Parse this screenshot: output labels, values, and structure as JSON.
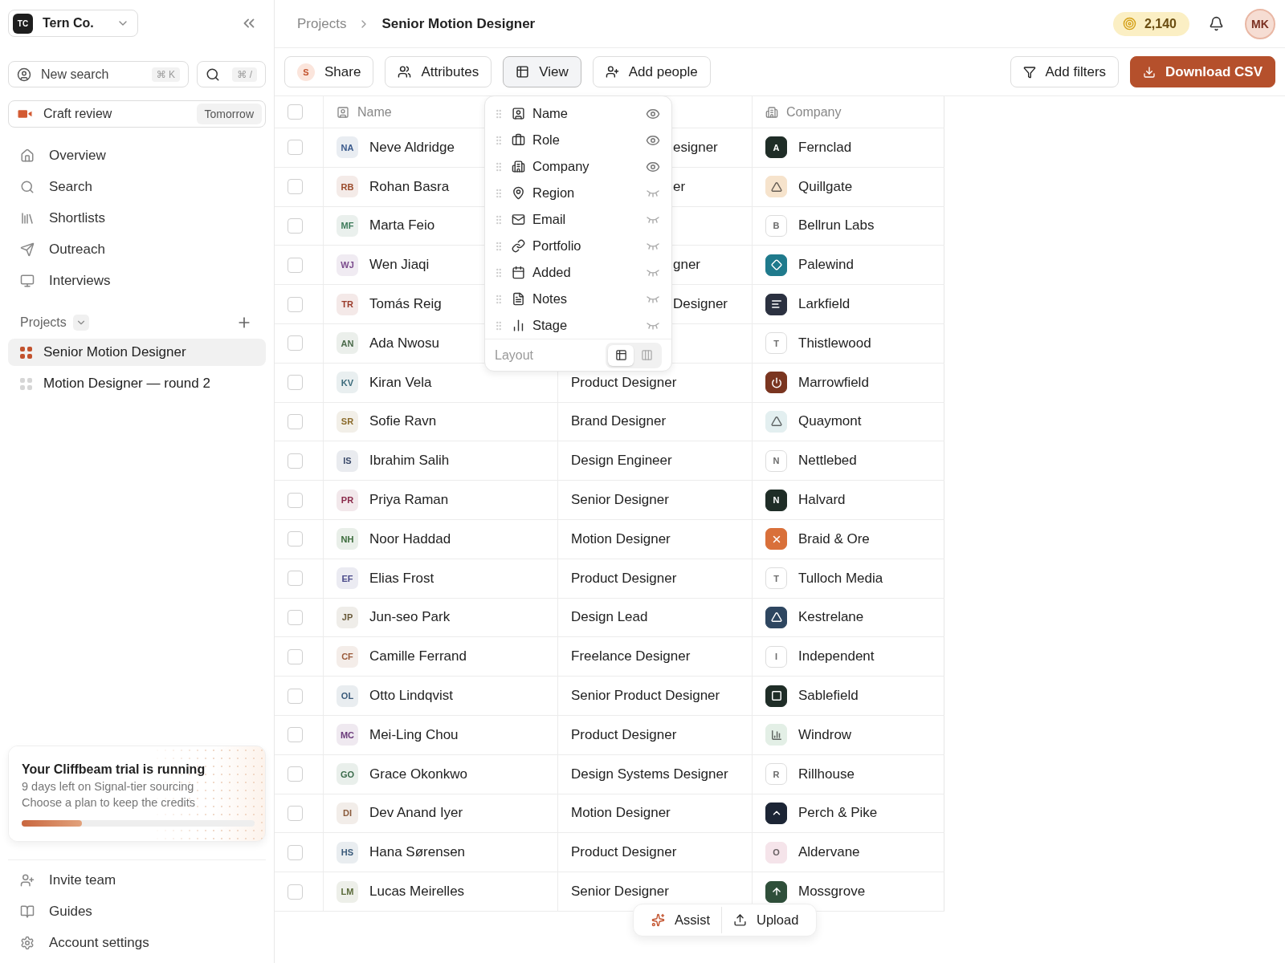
{
  "workspace": {
    "initials": "TC",
    "name": "Tern Co."
  },
  "quick": {
    "new_search": "New search",
    "new_search_shortcut": "⌘ K",
    "search_shortcut": "⌘ /"
  },
  "meeting": {
    "title": "Craft review",
    "when": "Tomorrow"
  },
  "nav": [
    "Overview",
    "Search",
    "Shortlists",
    "Outreach",
    "Interviews"
  ],
  "projects": {
    "title": "Projects",
    "items": [
      {
        "label": "Senior Motion Designer",
        "selected": true
      },
      {
        "label": "Motion Designer — round 2",
        "selected": false
      }
    ]
  },
  "trial": {
    "title": "Your Cliffbeam trial is running",
    "lines": [
      "9 days left on Signal-tier sourcing",
      "Choose a plan to keep the credits"
    ],
    "level": 0.26
  },
  "footer_nav": [
    "Invite team",
    "Guides",
    "Account settings"
  ],
  "breadcrumb": [
    "Projects",
    "Senior Motion Designer"
  ],
  "credits": "2,140",
  "user_initials": "MK",
  "toolbar": [
    {
      "label": "Share",
      "kind": "share",
      "badge": "S",
      "selected": false
    },
    {
      "label": "Attributes",
      "kind": "users",
      "selected": false
    },
    {
      "label": "View",
      "kind": "table",
      "selected": true
    },
    {
      "label": "Add people",
      "kind": "user-plus",
      "selected": false
    }
  ],
  "filters": "Add filters",
  "download": "Download CSV",
  "columns": {
    "name": "Name",
    "company": "Company",
    "all_checked": false
  },
  "rows": [
    {
      "checked": false,
      "initials": "NA",
      "color": "#3a5a8c",
      "name": "Neve Aldridge",
      "role": "esigner",
      "covered": true,
      "company": "Fernclad",
      "logo": {
        "kind": "letter",
        "text": "A",
        "color": "#1f2d27"
      }
    },
    {
      "checked": false,
      "initials": "RB",
      "color": "#9a4a2a",
      "name": "Rohan Basra",
      "role": "er",
      "covered": true,
      "company": "Quillgate",
      "logo": {
        "kind": "triangle",
        "color": "#f6e3cc"
      }
    },
    {
      "checked": false,
      "initials": "MF",
      "color": "#3d7a5a",
      "name": "Marta Feio",
      "company": "Bellrun Labs",
      "logo": {
        "kind": "letter",
        "text": "B",
        "color": "#ffffff"
      }
    },
    {
      "checked": false,
      "initials": "WJ",
      "color": "#7a4a8c",
      "name": "Wen Jiaqi",
      "role": "gner",
      "covered": true,
      "company": "Palewind",
      "logo": {
        "kind": "diamond",
        "color": "#1f7a8c"
      }
    },
    {
      "checked": false,
      "initials": "TR",
      "color": "#9a3a2a",
      "name": "Tomás Reig",
      "role": "Designer",
      "covered": true,
      "company": "Larkfield",
      "logo": {
        "kind": "lines",
        "color": "#2b3140"
      }
    },
    {
      "checked": false,
      "initials": "AN",
      "color": "#4a6a4a",
      "name": "Ada Nwosu",
      "company": "Thistlewood",
      "logo": {
        "kind": "letter",
        "text": "T",
        "color": "#ffffff"
      }
    },
    {
      "checked": false,
      "initials": "KV",
      "color": "#3a6a7a",
      "name": "Kiran Vela",
      "role": "Product Designer",
      "company": "Marrowfield",
      "logo": {
        "kind": "power",
        "color": "#7a3520"
      }
    },
    {
      "checked": false,
      "initials": "SR",
      "color": "#8a6a2a",
      "name": "Sofie Ravn",
      "role": "Brand Designer",
      "company": "Quaymont",
      "logo": {
        "kind": "triangle",
        "color": "#e3eff0"
      }
    },
    {
      "checked": false,
      "initials": "IS",
      "color": "#3a4a6a",
      "name": "Ibrahim Salih",
      "role": "Design Engineer",
      "company": "Nettlebed",
      "logo": {
        "kind": "letter",
        "text": "N",
        "color": "#ffffff"
      }
    },
    {
      "checked": false,
      "initials": "PR",
      "color": "#8a2a4a",
      "name": "Priya Raman",
      "role": "Senior Designer",
      "company": "Halvard",
      "logo": {
        "kind": "letter",
        "text": "N",
        "color": "#1f2d27"
      }
    },
    {
      "checked": false,
      "initials": "NH",
      "color": "#3a6a3a",
      "name": "Noor Haddad",
      "role": "Motion Designer",
      "company": "Braid & Ore",
      "logo": {
        "kind": "x",
        "color": "#d9703a"
      }
    },
    {
      "checked": false,
      "initials": "EF",
      "color": "#4a4a8a",
      "name": "Elias Frost",
      "role": "Product Designer",
      "company": "Tulloch Media",
      "logo": {
        "kind": "letter",
        "text": "T",
        "color": "#ffffff"
      }
    },
    {
      "checked": false,
      "initials": "JP",
      "color": "#6a5a3a",
      "name": "Jun-seo Park",
      "role": "Design Lead",
      "company": "Kestrelane",
      "logo": {
        "kind": "triangle",
        "color": "#2e4660"
      }
    },
    {
      "checked": false,
      "initials": "CF",
      "color": "#9a5a3a",
      "name": "Camille Ferrand",
      "role": "Freelance Designer",
      "company": "Independent",
      "logo": {
        "kind": "letter",
        "text": "I",
        "color": "#ffffff"
      }
    },
    {
      "checked": false,
      "initials": "OL",
      "color": "#3a5a7a",
      "name": "Otto Lindqvist",
      "role": "Senior Product Designer",
      "company": "Sablefield",
      "logo": {
        "kind": "square",
        "color": "#1f2d27"
      }
    },
    {
      "checked": false,
      "initials": "MC",
      "color": "#6a3a7a",
      "name": "Mei-Ling Chou",
      "role": "Product Designer",
      "company": "Windrow",
      "logo": {
        "kind": "bars",
        "color": "#e3efe6"
      }
    },
    {
      "checked": false,
      "initials": "GO",
      "color": "#3a6a4a",
      "name": "Grace Okonkwo",
      "role": "Design Systems Designer",
      "company": "Rillhouse",
      "logo": {
        "kind": "letter",
        "text": "R",
        "color": "#ffffff"
      }
    },
    {
      "checked": false,
      "initials": "DI",
      "color": "#8a5a3a",
      "name": "Dev Anand Iyer",
      "role": "Motion Designer",
      "company": "Perch & Pike",
      "logo": {
        "kind": "caret",
        "color": "#1c2535"
      }
    },
    {
      "checked": false,
      "initials": "HS",
      "color": "#3a5a7a",
      "name": "Hana Sørensen",
      "role": "Product Designer",
      "company": "Aldervane",
      "logo": {
        "kind": "letter",
        "text": "O",
        "color": "#f5e4ea"
      }
    },
    {
      "checked": false,
      "initials": "LM",
      "color": "#5a6a3a",
      "name": "Lucas Meirelles",
      "role": "Senior Designer",
      "company": "Mossgrove",
      "logo": {
        "kind": "arrow",
        "color": "#2f4f3a"
      }
    }
  ],
  "view_menu": {
    "fields": [
      {
        "label": "Name",
        "visible": true
      },
      {
        "label": "Role",
        "visible": true
      },
      {
        "label": "Company",
        "visible": true
      },
      {
        "label": "Region",
        "visible": false
      },
      {
        "label": "Email",
        "visible": false
      },
      {
        "label": "Portfolio",
        "visible": false
      },
      {
        "label": "Added",
        "visible": false
      },
      {
        "label": "Notes",
        "visible": false
      },
      {
        "label": "Stage",
        "visible": false
      }
    ],
    "layout_label": "Layout",
    "layouts": [
      {
        "kind": "table",
        "selected": true
      },
      {
        "kind": "columns",
        "selected": false
      }
    ]
  },
  "floating": [
    "Assist",
    "Upload"
  ]
}
